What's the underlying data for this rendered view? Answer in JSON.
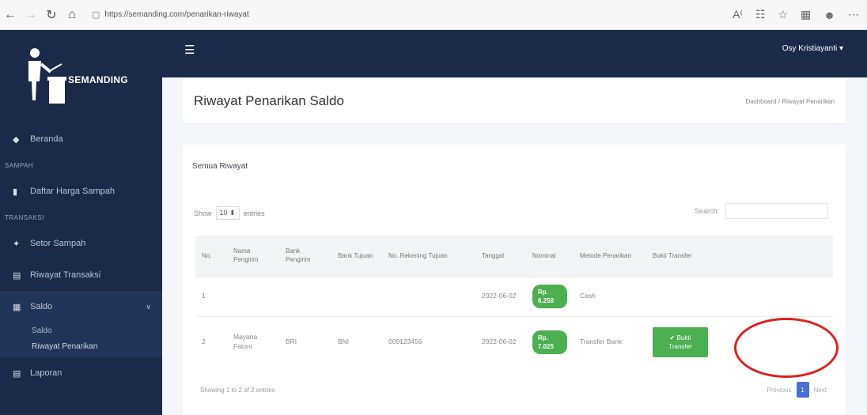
{
  "browser": {
    "url": "https://semanding.com/penarikan-riwayat",
    "icons": [
      "back-icon",
      "forward-icon",
      "refresh-icon",
      "home-icon",
      "lock-icon",
      "read-aloud-icon",
      "favorites-icon",
      "star-icon",
      "collections-icon",
      "profile-icon",
      "more-icon"
    ]
  },
  "sidebar": {
    "brand": "SEMANDING",
    "items": [
      {
        "type": "item",
        "label": "Beranda",
        "icon": "home-icon"
      },
      {
        "type": "head",
        "label": "SAMPAH"
      },
      {
        "type": "item",
        "label": "Daftar Harga Sampah",
        "icon": "trash-icon"
      },
      {
        "type": "head",
        "label": "TRANSAKSI"
      },
      {
        "type": "item",
        "label": "Setor Sampah",
        "icon": "deposit-icon"
      },
      {
        "type": "item",
        "label": "Riwayat Transaksi",
        "icon": "receipt-icon"
      },
      {
        "type": "item",
        "label": "Saldo",
        "icon": "wallet-icon",
        "expanded": true
      },
      {
        "type": "item",
        "label": "Laporan",
        "icon": "report-icon"
      }
    ],
    "saldo_sub": [
      "Saldo",
      "Riwayat Penarikan"
    ]
  },
  "topbar": {
    "user": "Osy Kristiayanti ▾"
  },
  "header": {
    "title": "Riwayat Penarikan Saldo",
    "breadcrumb": "Dashboard / Riwayat Penarikan"
  },
  "card": {
    "title": "Semua Riwayat",
    "show_label": "Show",
    "show_value": "10 ⬍",
    "entries_label": "entries",
    "search_label": "Search:",
    "columns": [
      "No.",
      "Nama Pengirim",
      "Bank Pengirim",
      "Bank Tujuan",
      "No. Rekening Tujuan",
      "Tanggal",
      "Nominal",
      "Metode Penarikan",
      "Bukti Transfer"
    ],
    "rows": [
      {
        "no": "1",
        "nama": "",
        "bank_pengirim": "",
        "bank_tujuan": "",
        "rekening": "",
        "tanggal": "2022-06-02",
        "nominal": "Rp. 6.250",
        "metode": "Cash",
        "bukti": ""
      },
      {
        "no": "2",
        "nama": "Mayana Fatoni",
        "bank_pengirim": "BRI",
        "bank_tujuan": "BNI",
        "rekening": "009123456",
        "tanggal": "2022-06-02",
        "nominal": "Rp. 7.025",
        "metode": "Transfer Bank",
        "bukti": "✔ Bukti Transfer"
      }
    ],
    "showing": "Showing 1 to 2 of 2 entries",
    "pager": {
      "previous": "Previous",
      "page": "1",
      "next": "Next"
    }
  },
  "colors": {
    "sidebar": "#1b2a48",
    "badge": "#4caf50",
    "accent": "#4a6fd8",
    "annotation": "#e01e1e"
  }
}
